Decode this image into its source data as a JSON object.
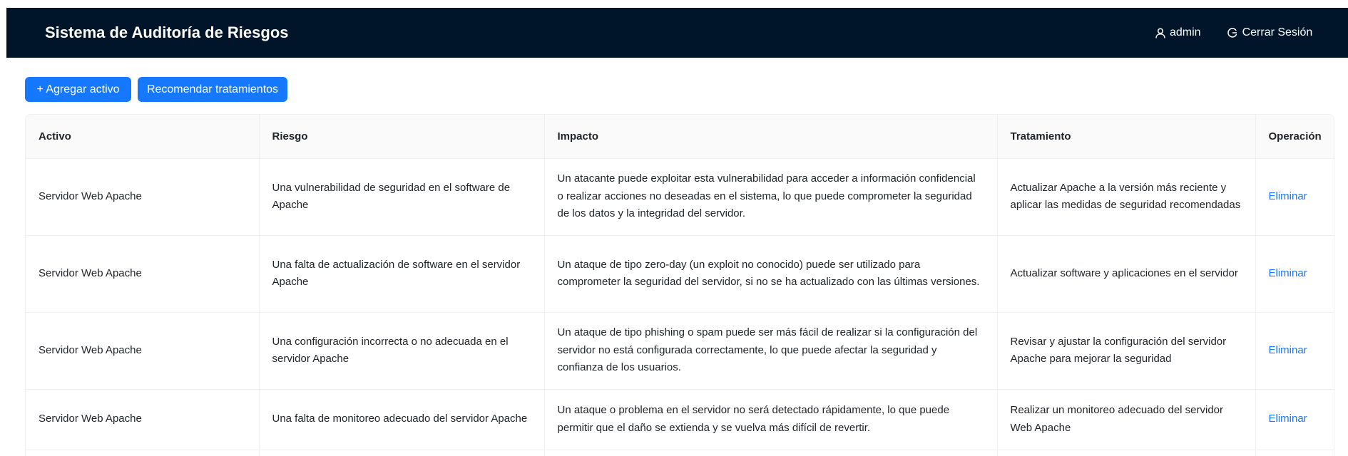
{
  "header": {
    "title": "Sistema de Auditoría de Riesgos",
    "user_label": "admin",
    "user_icon": "user-icon",
    "logout_label": "Cerrar Sesión",
    "logout_icon": "logout-icon"
  },
  "toolbar": {
    "add_label": "+ Agregar activo",
    "recommend_label": "Recomendar tratamientos"
  },
  "table": {
    "columns": [
      "Activo",
      "Riesgo",
      "Impacto",
      "Tratamiento",
      "Operación"
    ],
    "rows": [
      {
        "activo": "Servidor Web Apache",
        "riesgo": "Una vulnerabilidad de seguridad en el software de Apache",
        "impacto": "Un atacante puede exploitar esta vulnerabilidad para acceder a información confidencial o realizar acciones no deseadas en el sistema, lo que puede comprometer la seguridad de los datos y la integridad del servidor.",
        "tratamiento": "Actualizar Apache a la versión más reciente y aplicar las medidas de seguridad recomendadas",
        "operacion": "Eliminar"
      },
      {
        "activo": "Servidor Web Apache",
        "riesgo": "Una falta de actualización de software en el servidor Apache",
        "impacto": "Un ataque de tipo zero-day (un exploit no conocido) puede ser utilizado para comprometer la seguridad del servidor, si no se ha actualizado con las últimas versiones.",
        "tratamiento": "Actualizar software y aplicaciones en el servidor",
        "operacion": "Eliminar"
      },
      {
        "activo": "Servidor Web Apache",
        "riesgo": "Una configuración incorrecta o no adecuada en el servidor Apache",
        "impacto": "Un ataque de tipo phishing o spam puede ser más fácil de realizar si la configuración del servidor no está configurada correctamente, lo que puede afectar la seguridad y confianza de los usuarios.",
        "tratamiento": "Revisar y ajustar la configuración del servidor Apache para mejorar la seguridad",
        "operacion": "Eliminar"
      },
      {
        "activo": "Servidor Web Apache",
        "riesgo": "Una falta de monitoreo adecuado del servidor Apache",
        "impacto": "Un ataque o problema en el servidor no será detectado rápidamente, lo que puede permitir que el daño se extienda y se vuelva más difícil de revertir.",
        "tratamiento": "Realizar un monitoreo adecuado del servidor Web Apache",
        "operacion": "Eliminar"
      }
    ]
  },
  "colors": {
    "header_bg": "#001529",
    "primary": "#1677ff",
    "table_header_bg": "#fafafa",
    "border": "#f0f0f0"
  }
}
